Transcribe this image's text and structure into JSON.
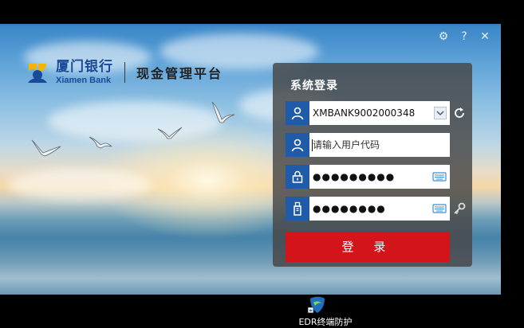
{
  "window": {
    "controls": [
      {
        "name": "settings",
        "icon": "gear-icon",
        "glyph": "⚙"
      },
      {
        "name": "help",
        "icon": "help-icon",
        "glyph": "?"
      },
      {
        "name": "close",
        "icon": "close-icon",
        "glyph": "✕"
      }
    ]
  },
  "brand": {
    "name_cn": "厦门银行",
    "name_en": "Xiamen Bank",
    "platform": "现金管理平台",
    "accent": "#1a4a9a",
    "logo_yellow": "#f5b400"
  },
  "login": {
    "title": "系统登录",
    "account": {
      "value": "XMBANK9002000348"
    },
    "user_code": {
      "placeholder": "请输入用户代码"
    },
    "password": {
      "mask": "●●●●●●●●●"
    },
    "certificate_password": {
      "mask": "●●●●●●●●"
    },
    "submit_label": "登 录",
    "submit_color": "#d4141b"
  },
  "desktop": {
    "icon_label": "EDR终端防护"
  }
}
